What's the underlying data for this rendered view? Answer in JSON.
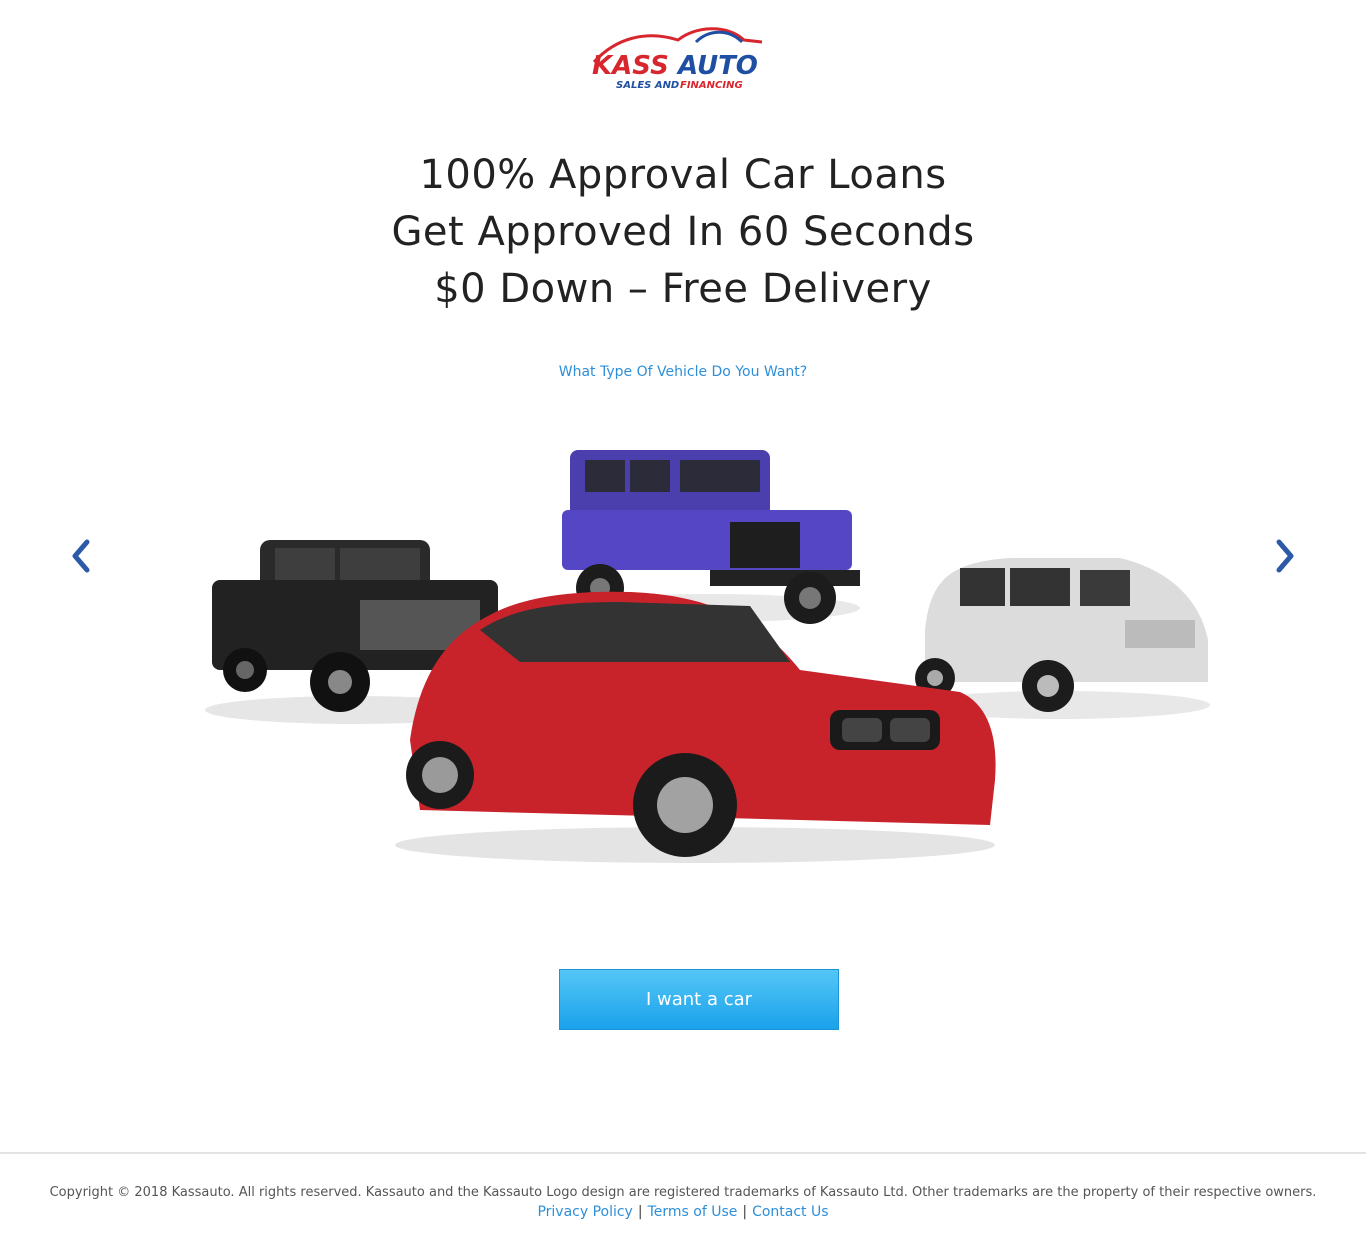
{
  "logo": {
    "brand": "KASS AUTO",
    "tagline_part1": "SALES AND",
    "tagline_part2": "FINANCING",
    "colors": {
      "red": "#d8262e",
      "blue": "#1f4fa3"
    }
  },
  "headline": {
    "line1": "100% Approval Car Loans",
    "line2": "Get Approved In 60 Seconds",
    "line3": "$0 Down – Free Delivery"
  },
  "question": "What Type Of Vehicle Do You Want?",
  "carousel": {
    "prev_icon": "chevron-left-icon",
    "next_icon": "chevron-right-icon",
    "vehicles": [
      "black pickup truck",
      "purple jeep",
      "red sedan",
      "silver minivan"
    ]
  },
  "cta": {
    "label": "I want a car"
  },
  "footer": {
    "copyright": "Copyright © 2018 Kassauto. All rights reserved. Kassauto and the Kassauto Logo design are registered trademarks of Kassauto Ltd. Other trademarks are the property of their respective owners.",
    "links": [
      "Privacy Policy",
      "Terms of Use",
      "Contact Us"
    ],
    "separator": "|"
  },
  "colors": {
    "accent": "#2e8fd8",
    "button_top": "#55c6f6",
    "button_bottom": "#1aa2eb",
    "arrow": "#2d5aa8"
  }
}
